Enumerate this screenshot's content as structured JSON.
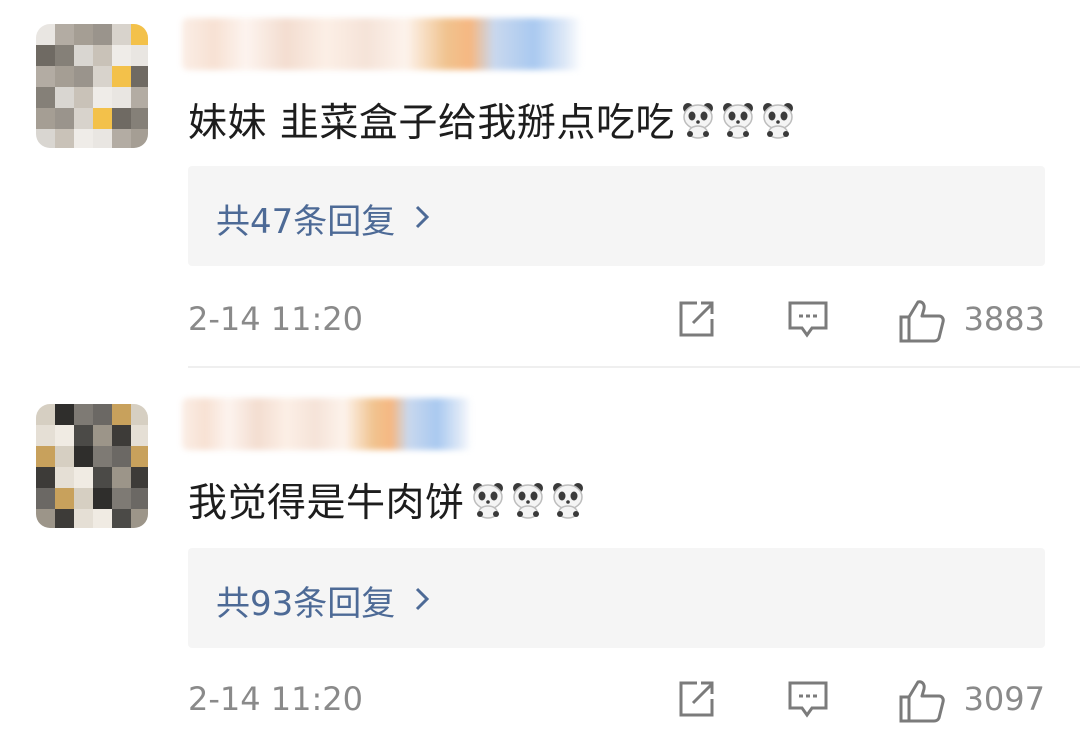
{
  "comments": [
    {
      "text": "妹妹 韭菜盒子给我掰点吃吃",
      "emoji": [
        "panda-emoji",
        "panda-emoji",
        "panda-emoji"
      ],
      "replies_label": "共47条回复",
      "time": "2-14 11:20",
      "likes": "3883"
    },
    {
      "text": "我觉得是牛肉饼",
      "emoji": [
        "panda-emoji",
        "panda-emoji",
        "panda-emoji"
      ],
      "replies_label": "共93条回复",
      "time": "2-14 11:20",
      "likes": "3097"
    }
  ],
  "colors": {
    "reply_link": "#4d6a96",
    "meta_gray": "#8a8a8a",
    "reply_box_bg": "#f5f5f5"
  }
}
